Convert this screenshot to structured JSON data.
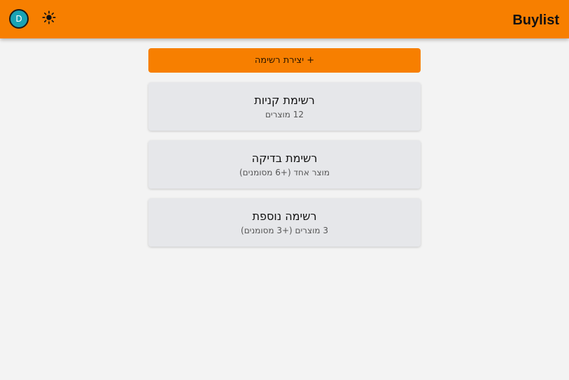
{
  "header": {
    "avatar_initial": "D",
    "theme_icon": "sun-icon",
    "app_title": "Buylist",
    "color": "#f77f00"
  },
  "create_button": {
    "label": "+ יצירת רשימה"
  },
  "lists": [
    {
      "name": "רשימת קניות",
      "count": "12 מוצרים"
    },
    {
      "name": "רשימת בדיקה",
      "count": "מוצר אחד (+6 מסומנים)"
    },
    {
      "name": "רשימה נוספת",
      "count": "3 מוצרים (+3 מסומנים)"
    }
  ]
}
